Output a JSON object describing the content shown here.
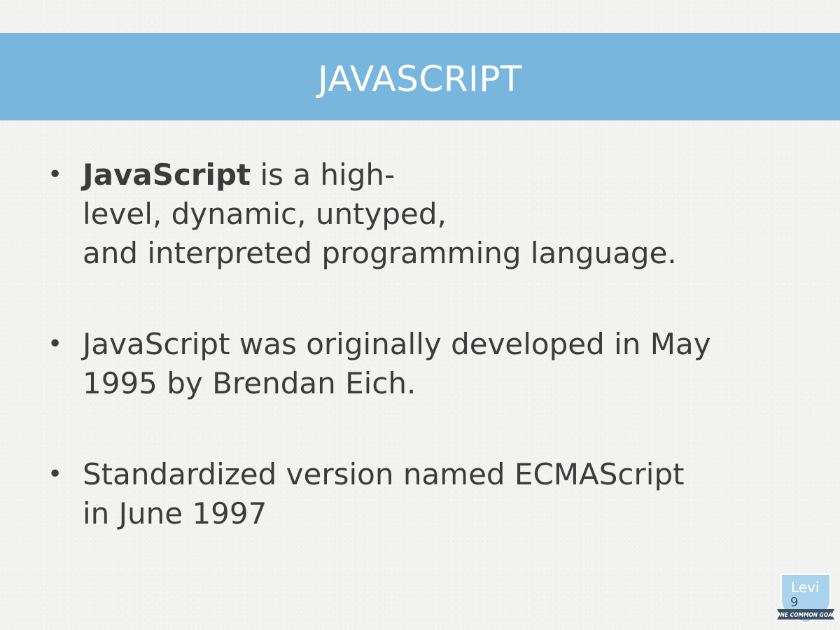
{
  "slide": {
    "title": "JAVASCRIPT"
  },
  "bullets": [
    {
      "lines": [
        {
          "bold": "JavaScript",
          "text": " is a high-"
        },
        {
          "text": "level, dynamic, untyped,"
        },
        {
          "text": "and interpreted programming language."
        }
      ]
    },
    {
      "lines": [
        {
          "text": "JavaScript was originally developed in May"
        },
        {
          "text": "1995 by Brendan Eich."
        }
      ]
    },
    {
      "lines": [
        {
          "text": "Standardized version named ECMAScript"
        },
        {
          "text": "in June 1997"
        }
      ]
    }
  ],
  "logo": {
    "name": "Levi",
    "number": "9",
    "tagline": "ONE COMMON GOAL",
    "colors": {
      "shield": "#a9d3ec",
      "ribbon": "#3a5066"
    }
  },
  "colors": {
    "title_band": "#79b6de",
    "title_text": "#ffffff",
    "body_text": "#3b3b3b",
    "background": "#f2f2f1"
  },
  "bullet_glyph": "•"
}
